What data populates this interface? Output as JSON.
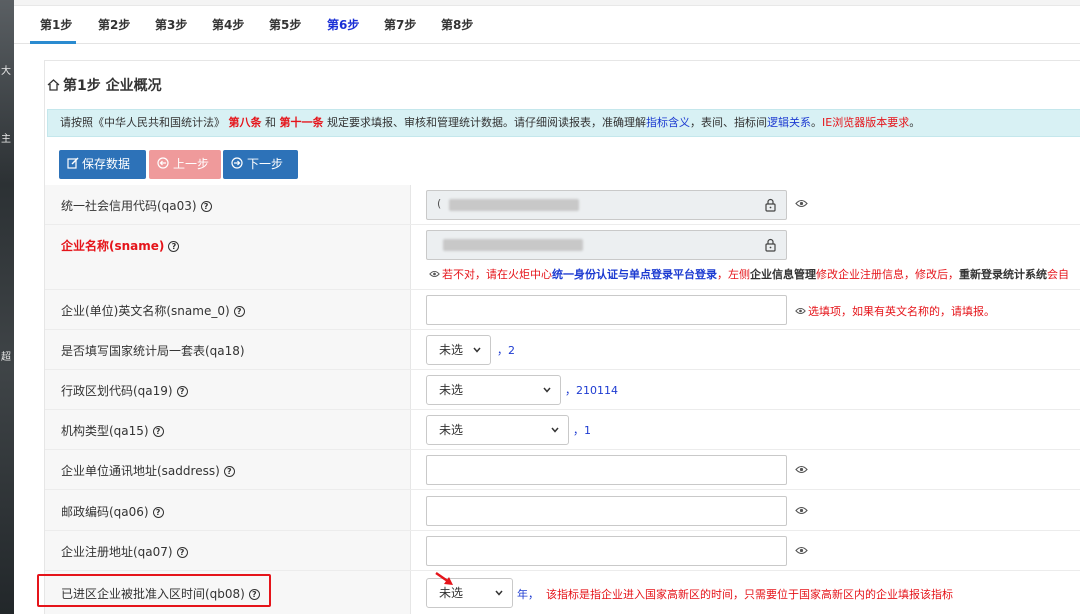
{
  "side_chars": [
    "大",
    "主",
    "超"
  ],
  "tabs": [
    "第1步",
    "第2步",
    "第3步",
    "第4步",
    "第5步",
    "第6步",
    "第7步",
    "第8步"
  ],
  "active_tab": "第1步",
  "highlight_tab": "第6步",
  "panel": {
    "title": "第1步 企业概况"
  },
  "notice": {
    "p1": "请按照《中华人民共和国统计法》",
    "p2": "第八条",
    "p3": "和",
    "p4": "第十一条",
    "p5": "规定要求填报、审核和管理统计数据。请仔细阅读报表，准确理解",
    "p6": "指标含义",
    "p7": "，表间、指标间",
    "p8": "逻辑关系",
    "p9": "。",
    "p10": "IE浏览器版本要求",
    "p11": "。"
  },
  "buttons": {
    "save": "保存数据",
    "prev": "上一步",
    "next": "下一步"
  },
  "fields": {
    "qa03": {
      "label": "统一社会信用代码(qa03)",
      "value_prefix": "("
    },
    "sname": {
      "label": "企业名称(sname)",
      "hint_a": "若不对，请在火炬中心",
      "hint_b": "统一身份认证与单点登录平台登录",
      "hint_c": "，左侧",
      "hint_d": "企业信息管理",
      "hint_e": "修改企业注册信息，修改后，",
      "hint_f": "重新登录统计系统",
      "hint_g": "会自"
    },
    "sname_0": {
      "label": "企业(单位)英文名称(sname_0)",
      "hint": "选填项，如果有英文名称的，请填报。"
    },
    "qa18": {
      "label": "是否填写国家统计局一套表(qa18)",
      "selected": "未选",
      "value": "，2"
    },
    "qa19": {
      "label": "行政区划代码(qa19)",
      "selected": "未选",
      "value": "，210114"
    },
    "qa15": {
      "label": "机构类型(qa15)",
      "selected": "未选",
      "value": "，1"
    },
    "saddress": {
      "label": "企业单位通讯地址(saddress)"
    },
    "qa06": {
      "label": "邮政编码(qa06)"
    },
    "qa07": {
      "label": "企业注册地址(qa07)"
    },
    "qb08": {
      "label": "已进区企业被批准入区时间(qb08)",
      "selected": "未选",
      "unit": "年，",
      "hint": "该指标是指企业进入国家高新区的时间，只需要位于国家高新区内的企业填报该指标"
    }
  },
  "colors": {
    "accent": "#2d72b8",
    "danger": "#e5141a",
    "link": "#1d3bd1",
    "notice_bg": "#d8f1f4"
  }
}
